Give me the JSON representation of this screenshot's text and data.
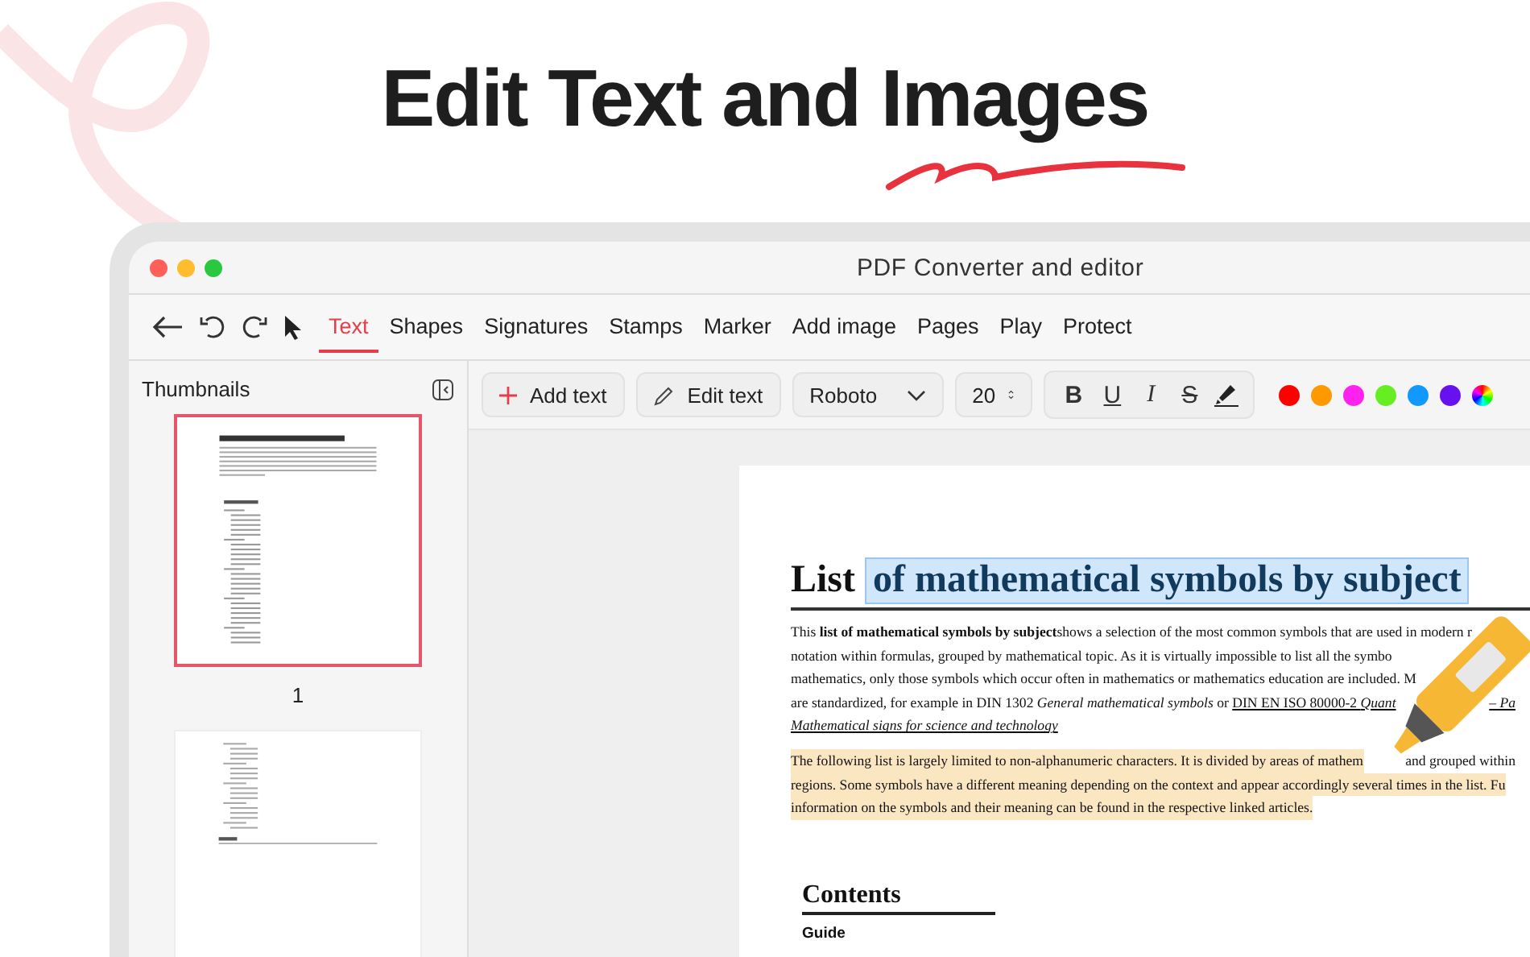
{
  "headline": {
    "text": "Edit Text and Images"
  },
  "window": {
    "title": "PDF Converter and editor"
  },
  "tabs": [
    {
      "label": "Text",
      "selected": true
    },
    {
      "label": "Shapes",
      "selected": false
    },
    {
      "label": "Signatures",
      "selected": false
    },
    {
      "label": "Stamps",
      "selected": false
    },
    {
      "label": "Marker",
      "selected": false
    },
    {
      "label": "Add image",
      "selected": false
    },
    {
      "label": "Pages",
      "selected": false
    },
    {
      "label": "Play",
      "selected": false
    },
    {
      "label": "Protect",
      "selected": false
    }
  ],
  "sidebar": {
    "title": "Thumbnails",
    "thumbnails": [
      {
        "label": "1",
        "selected": true
      },
      {
        "selected": false
      }
    ]
  },
  "format_bar": {
    "add_text": "Add text",
    "edit_text": "Edit text",
    "font": "Roboto",
    "size": "20",
    "styles": [
      {
        "label": "B",
        "kind": "bold"
      },
      {
        "label": "U",
        "kind": "underline"
      },
      {
        "label": "I",
        "kind": "italic"
      },
      {
        "label": "S",
        "kind": "strike"
      },
      {
        "kind": "highlight"
      }
    ],
    "colors": [
      {
        "color": "#ff0000"
      },
      {
        "color": "#ff9900"
      },
      {
        "color": "#ff22ee"
      },
      {
        "color": "#66ee22"
      },
      {
        "color": "#1199ff"
      },
      {
        "color": "#6611ee"
      },
      {
        "kind": "picker"
      }
    ]
  },
  "document": {
    "title": "List",
    "title_selection": "of mathematical symbols by subject",
    "paragraphs": [
      {
        "highlighted": false,
        "lines": [
          {
            "spans": [
              {
                "text": "This **list of mathematical symbols by subject**shows a selection of the most common symbols that are used in modern r",
                "kind": "text"
              }
            ]
          },
          {
            "spans": [
              {
                "text": "notation within formulas, grouped by mathematical topic. As it is virtually impossible to list all the symbo",
                "kind": "text"
              }
            ]
          },
          {
            "spans": [
              {
                "text": "mathematics, only those symbols which occur often in mathematics or mathematics education are included. M",
                "kind": "text"
              }
            ]
          },
          {
            "spans": [
              {
                "text": "are standardized, for example in DIN 1302 *General mathematical symbols* or ",
                "kind": "text"
              },
              {
                "text": "DIN EN ISO 80000-2 *Quant*",
                "kind": "link"
              }
            ],
            "tail": [
              {
                "text": "*– Pa*",
                "kind": "link"
              }
            ]
          },
          {
            "spans": [
              {
                "text": "*Mathematical signs for science and technology*",
                "kind": "link"
              }
            ]
          }
        ]
      },
      {
        "highlighted": true,
        "lines": [
          {
            "spans": [
              {
                "text": "The following list is largely limited to non-alphanumeric characters. It is divided by areas of mathem",
                "kind": "text"
              }
            ],
            "tail": [
              {
                "text": "and grouped within",
                "kind": "text"
              }
            ]
          },
          {
            "spans": [
              {
                "text": "regions. Some symbols have a different meaning depending on the context and appear accordingly several times in the list. Fu",
                "kind": "text"
              }
            ]
          },
          {
            "spans": [
              {
                "text": "information on the symbols and their meaning can be found in the respective linked articles.",
                "kind": "text"
              }
            ]
          }
        ]
      }
    ],
    "contents": {
      "title": "Contents",
      "items": [
        "Guide"
      ]
    }
  }
}
